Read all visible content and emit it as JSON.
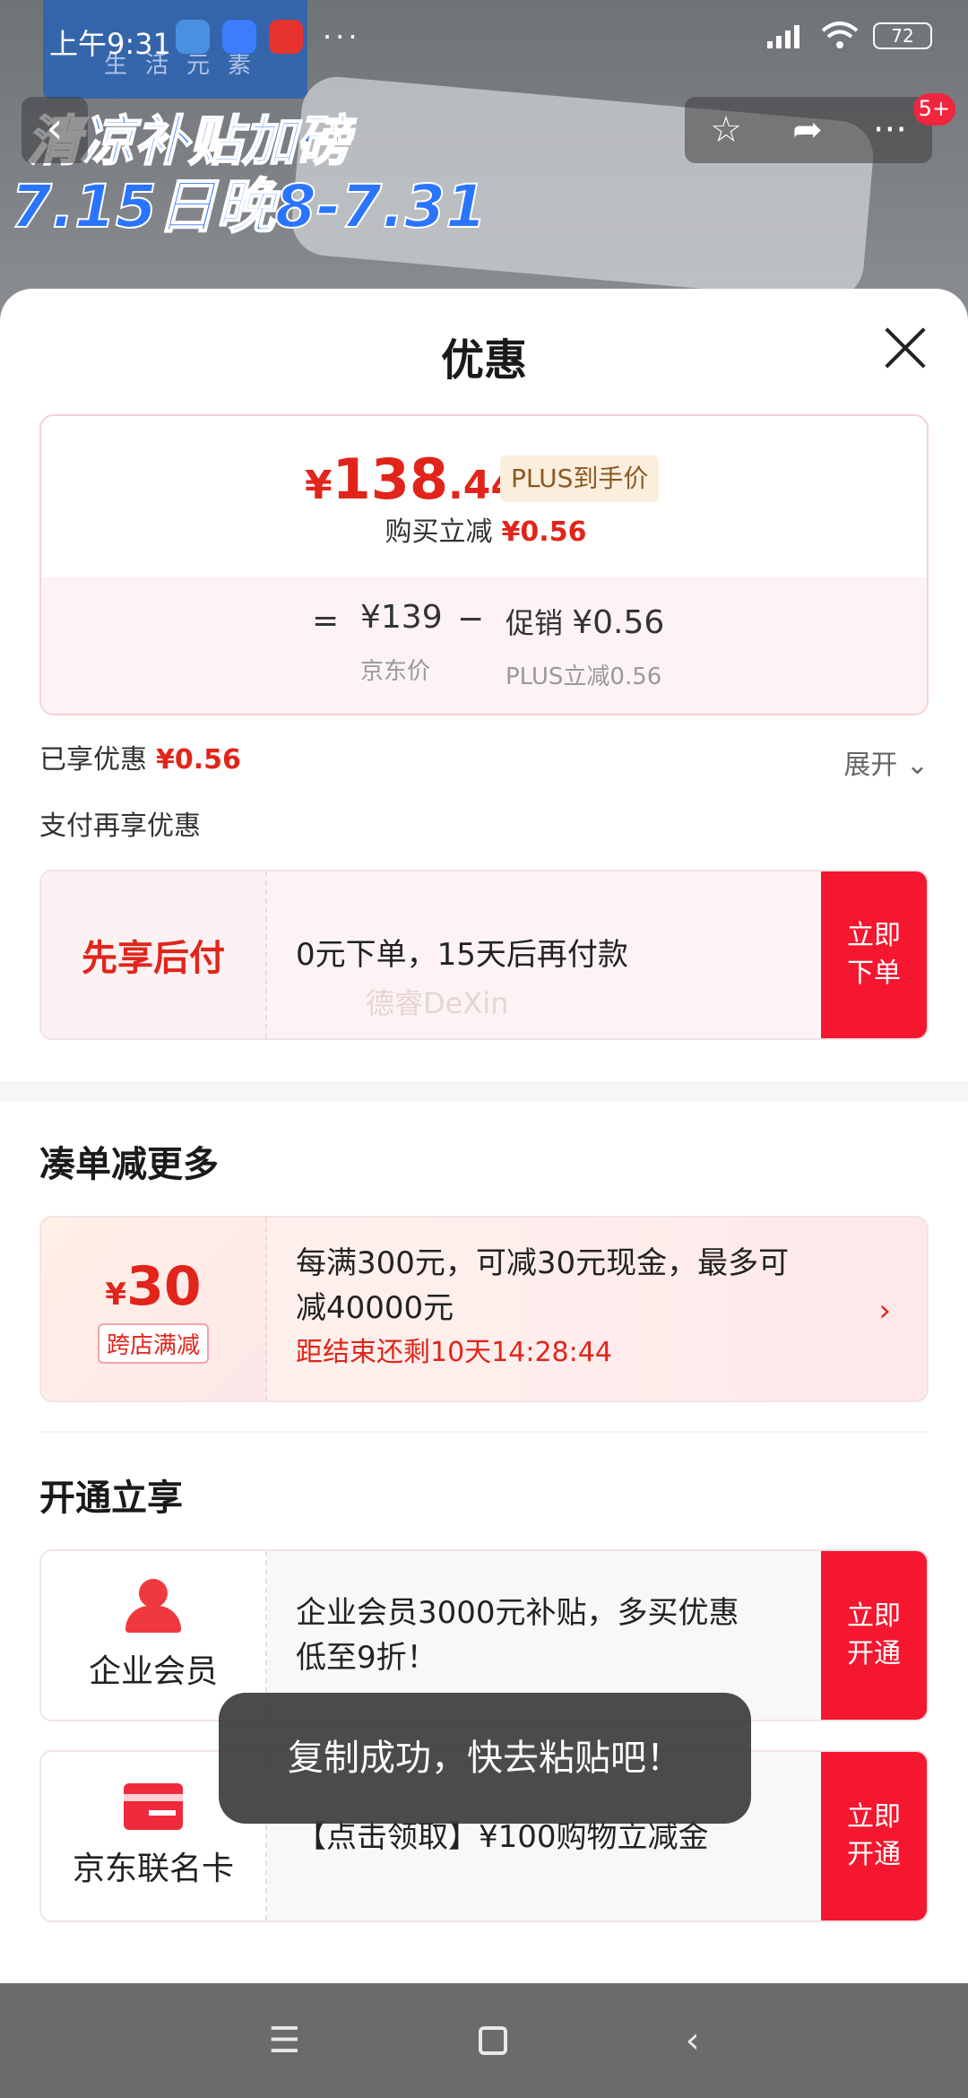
{
  "colors": {
    "accent_red": "#e1251b",
    "button_red": "#f5172f",
    "plus_gold": "#8a5a21"
  },
  "status_bar": {
    "time": "上午9:31",
    "battery": "72",
    "more": "···"
  },
  "background": {
    "brand": "生活元素",
    "promo_line1": "清凉补贴加磅",
    "promo_line2": "7.15日晚8-7.31"
  },
  "top_nav": {
    "badge": "5+"
  },
  "sheet": {
    "title": "优惠",
    "price": {
      "currency": "¥",
      "integer": "138",
      "decimal": ".44",
      "plus_tag": "PLUS到手价",
      "instant_label": "购买立减",
      "instant_amount": "¥0.56",
      "equals": "=",
      "jd_price": "¥139",
      "jd_label": "京东价",
      "minus": "−",
      "promo_label_inline": "促销",
      "promo_amount": "¥0.56",
      "promo_sub": "PLUS立减0.56"
    },
    "enjoyed": {
      "label": "已享优惠",
      "amount": "¥0.56",
      "expand": "展开"
    },
    "pay_more": "支付再享优惠",
    "bnpl": {
      "title": "先享后付",
      "desc": "0元下单，15天后再付款",
      "button_l1": "立即",
      "button_l2": "下单",
      "watermark": "德睿DeXin"
    },
    "cross_section_title": "凑单减更多",
    "cross": {
      "currency": "¥",
      "amount": "30",
      "tag": "跨店满减",
      "desc_l1": "每满300元，可减30元现金，最多可",
      "desc_l2": "减40000元",
      "countdown": "距结束还剩10天14:28:44"
    },
    "open_section_title": "开通立享",
    "member": {
      "label": "企业会员",
      "desc_l1": "企业会员3000元补贴，多买优惠",
      "desc_l2": "低至9折！",
      "button_l1": "立即",
      "button_l2": "开通"
    },
    "jdcard": {
      "label": "京东联名卡",
      "desc": "【点击领取】¥100购物立减金",
      "button_l1": "立即",
      "button_l2": "开通"
    }
  },
  "toast": "复制成功，快去粘贴吧！",
  "icons": [
    "back-icon",
    "star-icon",
    "share-icon",
    "more-icon",
    "close-icon",
    "chevron-down-icon",
    "chevron-right-icon",
    "person-icon",
    "card-icon",
    "menu-icon",
    "home-icon",
    "nav-back-icon"
  ]
}
